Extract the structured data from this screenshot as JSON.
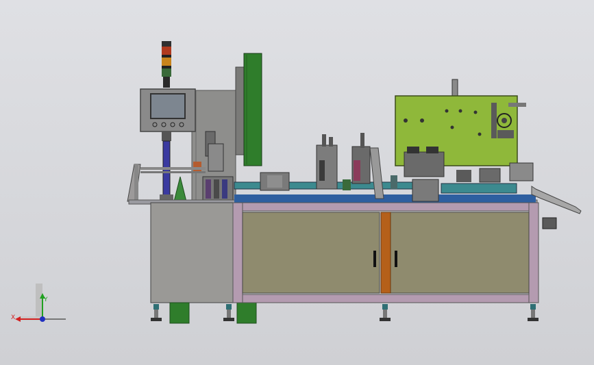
{
  "scene": {
    "description_type": "cad-assembly-front-view",
    "colors": {
      "background": "#d7d8dc",
      "frame_gray": "#8f8f8f",
      "panel_gray": "#9a9996",
      "door_olive": "#8f8b6e",
      "frame_rail": "#b49bb0",
      "accent_green": "#2f7d2b",
      "plate_green": "#8fb83a",
      "blue_column": "#3a3aa0",
      "orange_post": "#b5601a",
      "conveyor_teal": "#3c8a8f",
      "belt_blue": "#2e5fa0",
      "feet_teal": "#2f6f74"
    }
  },
  "triad": {
    "x_label": "X",
    "y_label": "Y",
    "x_color": "#d42020",
    "y_color": "#20a020",
    "z_color": "#2030c0"
  }
}
